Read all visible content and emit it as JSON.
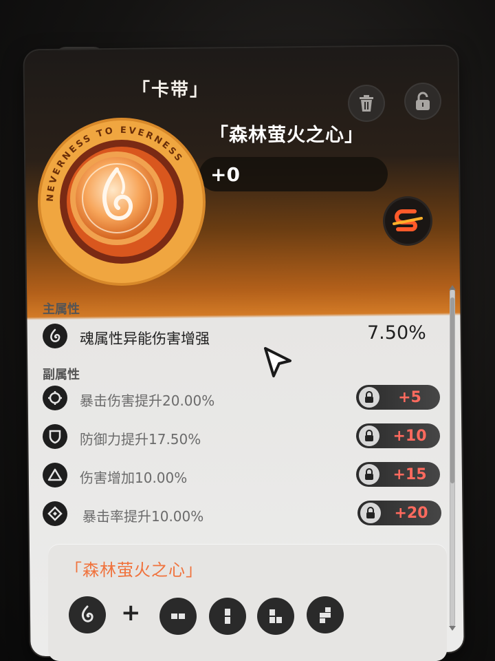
{
  "header": {
    "category_label": "「卡带」",
    "item_name": "「森林萤火之心」",
    "level": "+0"
  },
  "medal": {
    "ring_text": "NEVERNESS TO EVERNESS"
  },
  "main_attributes": {
    "title": "主属性",
    "items": [
      {
        "label": "魂属性异能伤害增强",
        "value": "7.50%",
        "icon": "soul-flame-icon"
      }
    ]
  },
  "sub_attributes": {
    "title": "副属性",
    "items": [
      {
        "label": "暴击伤害提升20.00%",
        "unlock": "+5",
        "icon": "crosshair-icon"
      },
      {
        "label": "防御力提升17.50%",
        "unlock": "+10",
        "icon": "shield-icon"
      },
      {
        "label": "伤害增加10.00%",
        "unlock": "+15",
        "icon": "triangle-icon"
      },
      {
        "label": "暴击率提升10.00%",
        "unlock": "+20",
        "icon": "crit-diamond-icon"
      }
    ]
  },
  "set": {
    "title": "「森林萤火之心」",
    "plus": "+"
  },
  "colors": {
    "accent_orange": "#f0723c",
    "unlock_red": "#ff6a5e",
    "panel_light": "#ececeb"
  }
}
